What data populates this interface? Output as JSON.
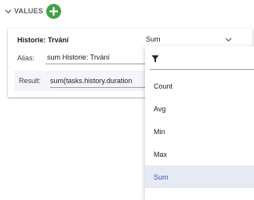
{
  "section": {
    "title": "VALUES"
  },
  "card": {
    "field_name": "Historie: Trvání",
    "aggregation": "Sum",
    "alias_label": "Alias:",
    "alias_value": "sum Historie: Trvání",
    "result_label": "Result:",
    "result_value": "sum(tasks.history.duration"
  },
  "dropdown": {
    "options": [
      "Count",
      "Avg",
      "Min",
      "Max",
      "Sum"
    ],
    "selected": "Sum"
  },
  "colors": {
    "add_button": "#43a047",
    "selected_text": "#3f51b5",
    "selected_bg": "#e6eaf5"
  },
  "icons": [
    "chevron-down-icon",
    "plus-icon",
    "filter-icon"
  ]
}
